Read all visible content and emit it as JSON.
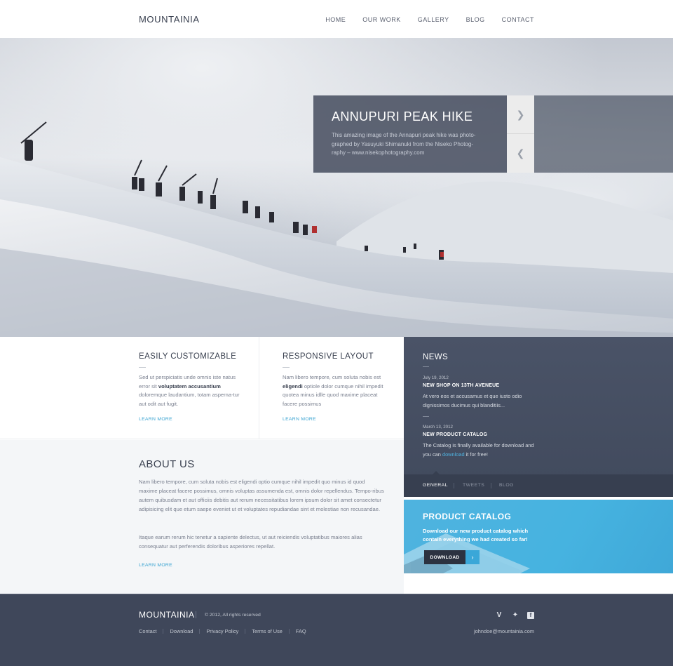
{
  "header": {
    "logo": "MOUNTAINIA",
    "nav": [
      "HOME",
      "OUR WORK",
      "GALLERY",
      "BLOG",
      "CONTACT"
    ]
  },
  "hero": {
    "title": "ANNUPURI PEAK HIKE",
    "caption": "This amazing image of the Annapuri peak hike was photo-graphed by Yasuyuki Shimanuki from the Niseko Photog-raphy – www.nisekophotography.com",
    "next_icon": "chevron-right-icon",
    "prev_icon": "chevron-left-icon"
  },
  "features": [
    {
      "title": "EASILY CUSTOMIZABLE",
      "text_before": "Sed ut perspiciatis unde omnis iste natus error sit ",
      "text_bold": "voluptatem accusantium",
      "text_after": " doloremque laudantium, totam asperna-tur aut odit aut fugit.",
      "link": "LEARN MORE"
    },
    {
      "title": "RESPONSIVE LAYOUT",
      "text_before": "Nam libero tempore, cum soluta nobis est ",
      "text_bold": "eligendi",
      "text_after": " optiole dolor cumque nihil impedit quotea minus idlle quod maxime placeat facere possimus",
      "link": "LEARN MORE"
    }
  ],
  "about": {
    "title": "ABOUT US",
    "p1": "Nam libero tempore, cum soluta nobis est eligendi optio cumque nihil impedit quo minus id quod maxime placeat facere possimus, omnis voluptas assumenda est, omnis dolor repellendus. Tempo-ribus autem quibusdam et aut officiis debitis aut rerum necessitatibus lorem ipsum dolor sit amet consectetur adipisicing elit que etum saepe eveniet ut et voluptates repudiandae sint et molestiae non recusandae.",
    "p2": "Itaque earum rerum hic tenetur a sapiente delectus, ut aut reiciendis voluptatibus maiores alias consequatur aut perferendis doloribus asperiores repellat.",
    "link": "LEARN MORE"
  },
  "news": {
    "title": "NEWS",
    "items": [
      {
        "date": "July 19, 2012",
        "headline": "NEW SHOP ON 13TH AVENEUE",
        "body": "At vero eos et accusamus et que iusto odio dignissimos ducimus qui blanditiis..."
      },
      {
        "date": "March 13, 2012",
        "headline": "NEW PRODUCT CATALOG",
        "body_before": "The Catalog is finally available for download and you can ",
        "body_link": "download",
        "body_after": " it for free!"
      }
    ],
    "tabs": [
      "GENERAL",
      "TWEETS",
      "BLOG"
    ],
    "active_tab": "GENERAL"
  },
  "catalog": {
    "title": "PRODUCT CATALOG",
    "text": "Download our new product catalog which contain everything we had created so far!",
    "button": "DOWNLOAD",
    "arrow_icon": "chevron-right-icon"
  },
  "footer": {
    "logo": "MOUNTAINIA",
    "copyright": "© 2012, All rights reserved",
    "links": [
      "Contact",
      "Download",
      "Privacy Policy",
      "Terms of Use",
      "FAQ"
    ],
    "social_icons": [
      "vimeo-icon",
      "twitter-icon",
      "facebook-icon"
    ],
    "social_glyphs": [
      "V",
      "✦",
      "f"
    ],
    "email": "johndoe@mountainia.com"
  },
  "colors": {
    "accent": "#39a3d1",
    "dark_panel": "#414a5d",
    "footer": "#3f475a",
    "catalog": "#46b3e0"
  }
}
